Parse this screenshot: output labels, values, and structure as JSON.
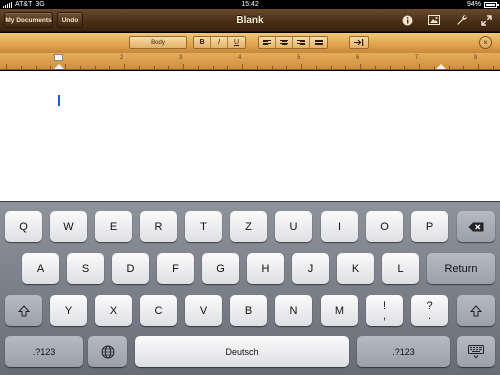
{
  "status_bar": {
    "carrier": "AT&T",
    "network": "3G",
    "time": "15:42",
    "battery": "94%"
  },
  "navbar": {
    "title": "Blank",
    "my_documents": "My Documents",
    "undo": "Undo",
    "icons": [
      "info-icon",
      "image-icon",
      "wrench-icon",
      "fullscreen-icon"
    ]
  },
  "toolbar": {
    "style": "Body",
    "bold": "B",
    "italic": "I",
    "underline": "U",
    "close": "×"
  },
  "ruler": {
    "numbers": [
      "2",
      "3",
      "4",
      "5",
      "6",
      "7",
      "8"
    ]
  },
  "keyboard": {
    "row1": [
      "Q",
      "W",
      "E",
      "R",
      "T",
      "Z",
      "U",
      "I",
      "O",
      "P"
    ],
    "row2": [
      "A",
      "S",
      "D",
      "F",
      "G",
      "H",
      "J",
      "K",
      "L"
    ],
    "return": "Return",
    "row3": [
      "Y",
      "X",
      "C",
      "V",
      "B",
      "N",
      "M"
    ],
    "punct1_top": "!",
    "punct1_bottom": ",",
    "punct2_top": "?",
    "punct2_bottom": ".",
    "numbers_label": ".?123",
    "space_label": "Deutsch"
  },
  "colors": {
    "accent_caret": "#1f5bd6",
    "navbar": "#4a2f17",
    "toolbar": "#dfa24d"
  }
}
